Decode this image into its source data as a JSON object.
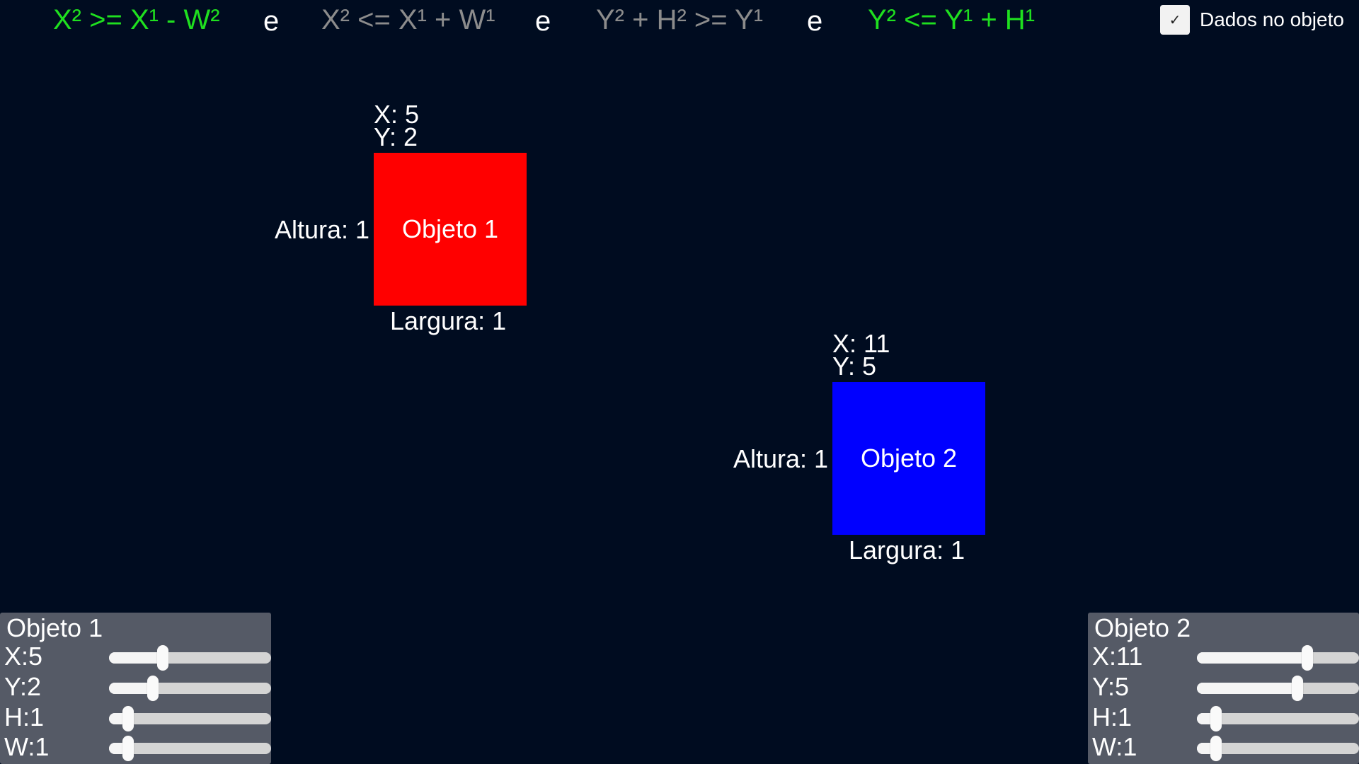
{
  "conditions": [
    {
      "text": "X² >= X¹ - W²",
      "satisfied": true
    },
    {
      "text": "X² <= X¹ + W¹",
      "satisfied": false
    },
    {
      "text": "Y² + H² >= Y¹",
      "satisfied": false
    },
    {
      "text": "Y² <= Y¹ + H¹",
      "satisfied": true
    }
  ],
  "conjunction": "e",
  "colors": {
    "background": "#000c20",
    "true_condition": "#1fe01f",
    "false_condition": "#8c8c8c",
    "object1": "#ff0000",
    "object2": "#0000ff",
    "panel": "#555a66"
  },
  "checkbox": {
    "label": "Dados no objeto",
    "checked": true,
    "icon": "checkmark-icon",
    "glyph": "✓"
  },
  "objects": [
    {
      "label": "Objeto 1",
      "x_text": "X: 5",
      "y_text": "Y: 2",
      "height_text": "Altura: 1",
      "width_text": "Largura: 1"
    },
    {
      "label": "Objeto 2",
      "x_text": "X: 11",
      "y_text": "Y: 5",
      "height_text": "Altura: 1",
      "width_text": "Largura: 1"
    }
  ],
  "panels": [
    {
      "title": "Objeto 1",
      "sliders": [
        {
          "label": "X:5",
          "fraction": 0.33
        },
        {
          "label": "Y:2",
          "fraction": 0.27
        },
        {
          "label": "H:1",
          "fraction": 0.12
        },
        {
          "label": "W:1",
          "fraction": 0.12
        }
      ]
    },
    {
      "title": "Objeto 2",
      "sliders": [
        {
          "label": "X:11",
          "fraction": 0.68
        },
        {
          "label": "Y:5",
          "fraction": 0.62
        },
        {
          "label": "H:1",
          "fraction": 0.12
        },
        {
          "label": "W:1",
          "fraction": 0.12
        }
      ]
    }
  ]
}
